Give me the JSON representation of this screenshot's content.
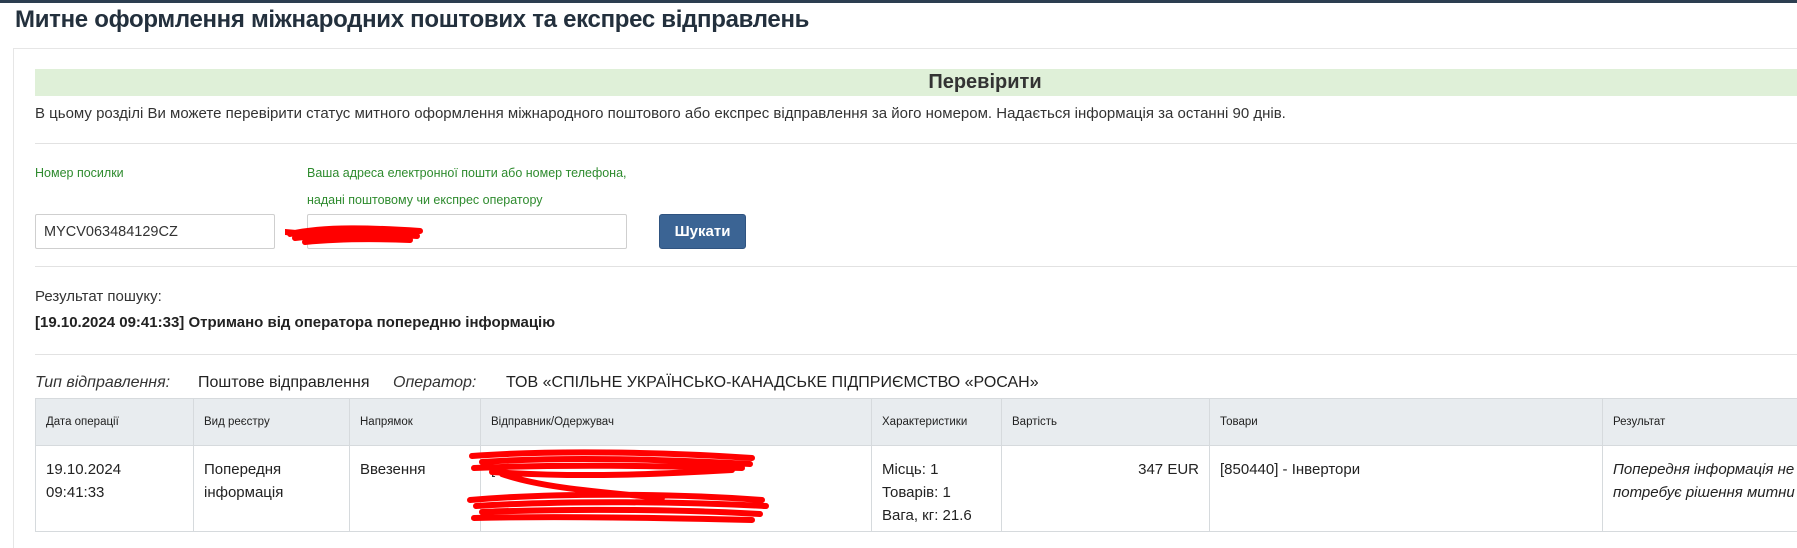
{
  "page": {
    "title": "Митне оформлення міжнародних поштових та експрес відправлень"
  },
  "check": {
    "title": "Перевірити",
    "intro": "В цьому розділі Ви можете перевірити статус митного оформлення міжнародного поштового або експрес відправлення за його номером. Надається інформація за останні 90 днів."
  },
  "form": {
    "parcel_label": "Номер посилки",
    "parcel_value": "MYCV063484129CZ",
    "contact_label_line1": "Ваша адреса електронної пошти або номер телефона,",
    "contact_label_line2": "надані поштовому чи експрес оператору",
    "contact_value": "",
    "search_button": "Шукати"
  },
  "result": {
    "label": "Результат пошуку:",
    "status": "[19.10.2024 09:41:33] Отримано від оператора попередню інформацію"
  },
  "shipment": {
    "type_label": "Тип відправлення:",
    "type_value": "Поштове відправлення",
    "operator_label": "Оператор:",
    "operator_value": "ТОВ «СПІЛЬНЕ УКРАЇНСЬКО-КАНАДСЬКЕ ПІДПРИЄМСТВО «РОСАН»"
  },
  "table": {
    "headers": [
      "Дата операції",
      "Вид реєстру",
      "Напрямок",
      "Відправник/Одержувач",
      "Характеристики",
      "Вартість",
      "Товари",
      "Результат"
    ],
    "rows": [
      {
        "date": "19.10.2024 09:41:33",
        "registry": "Попередня інформація",
        "direction": "Ввезення",
        "party": "[",
        "places": "Місць: 1",
        "goods_count": "Товарів: 1",
        "weight": "Вага, кг: 21.6",
        "value": "347 EUR",
        "goods": "[850440] - Інвертори",
        "result_line1": "Попередня інформація не",
        "result_line2": "потребує рішення митни"
      }
    ]
  },
  "colors": {
    "header_bar": "#dff0d8",
    "label_green": "#2e8b2e",
    "button": "#3b6494",
    "redaction": "#ff0000"
  }
}
